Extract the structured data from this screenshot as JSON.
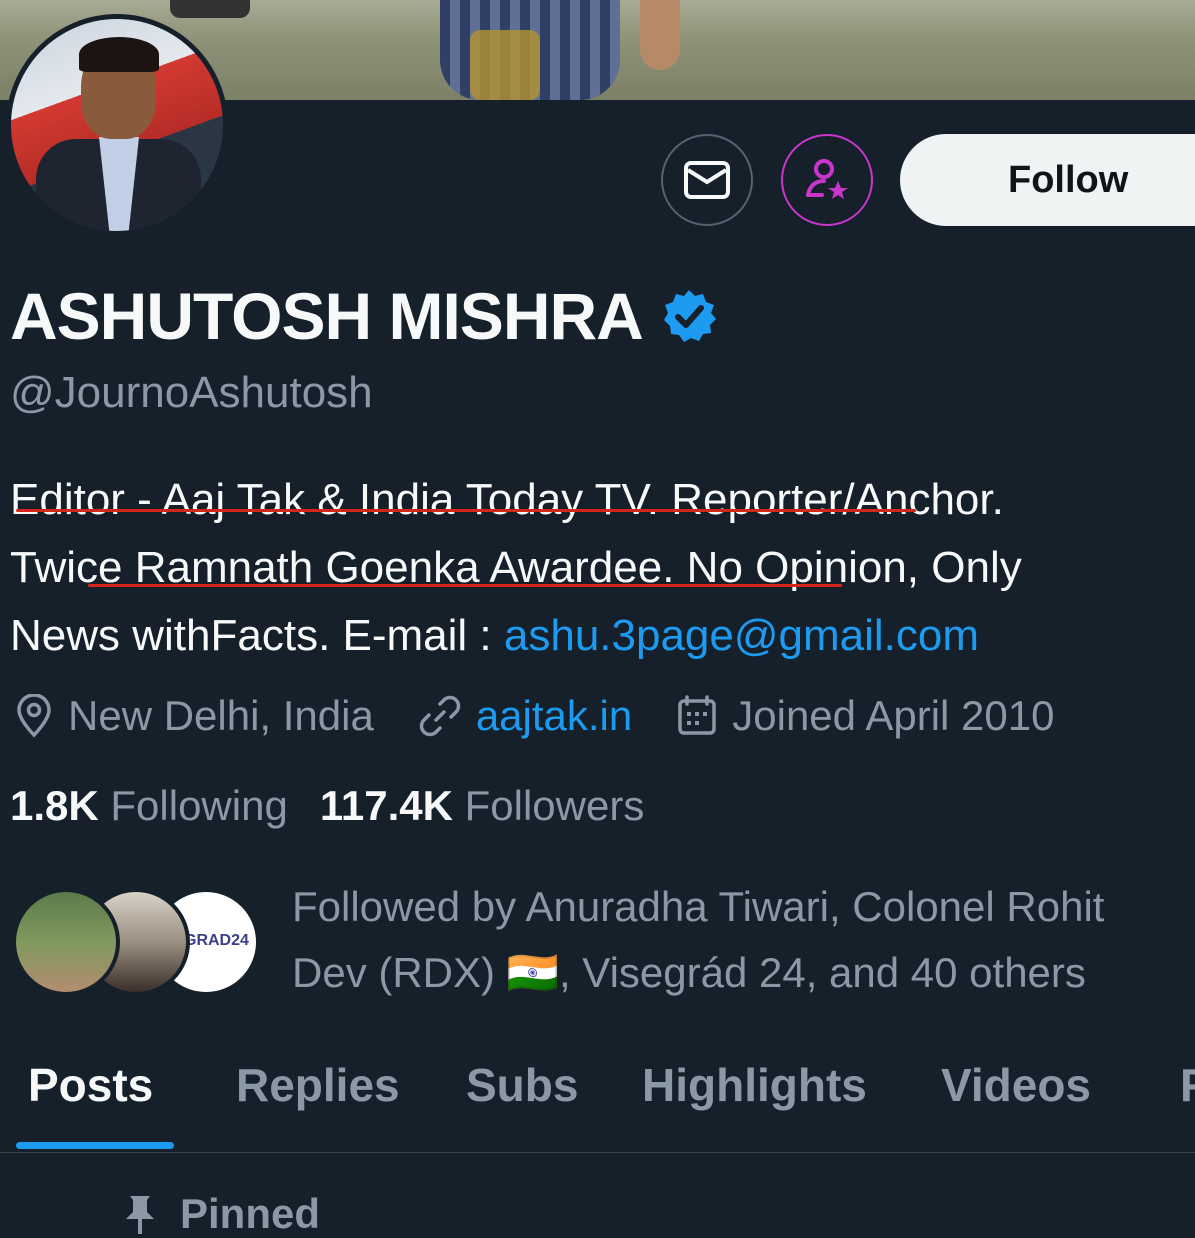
{
  "profile": {
    "name": "ASHUTOSH MISHRA",
    "handle": "@JournoAshutosh",
    "bio": {
      "line1": "Editor - Aaj Tak & India Today TV. Reporter/Anchor.",
      "line2": "Twice Ramnath Goenka Awardee. No Opinion, Only",
      "line3_text": "News withFacts. E-mail : ",
      "line3_link": "ashu.3page@gmail.com"
    },
    "location": "New Delhi, India",
    "website": "aajtak.in",
    "joined": "Joined April 2010",
    "following_count": "1.8K",
    "following_label": "Following",
    "followers_count": "117.4K",
    "followers_label": "Followers"
  },
  "actions": {
    "follow_label": "Follow",
    "message_icon": "mail-icon",
    "subscribe_icon": "subscribe-star-icon"
  },
  "followed_by": {
    "line1": "Followed by Anuradha Tiwari, Colonel Rohit",
    "line2": "Dev (RDX) 🇮🇳, Visegrád 24, and 40 others",
    "avatar3_text": "GRAD24"
  },
  "tabs": [
    "Posts",
    "Replies",
    "Subs",
    "Highlights",
    "Videos",
    "F"
  ],
  "active_tab": "Posts",
  "pinned_label": "Pinned",
  "colors": {
    "background": "#15202b",
    "accent": "#1d9bf0",
    "muted": "#8b98a5",
    "underline": "#d6261c",
    "subscribe": "#c936cc"
  }
}
